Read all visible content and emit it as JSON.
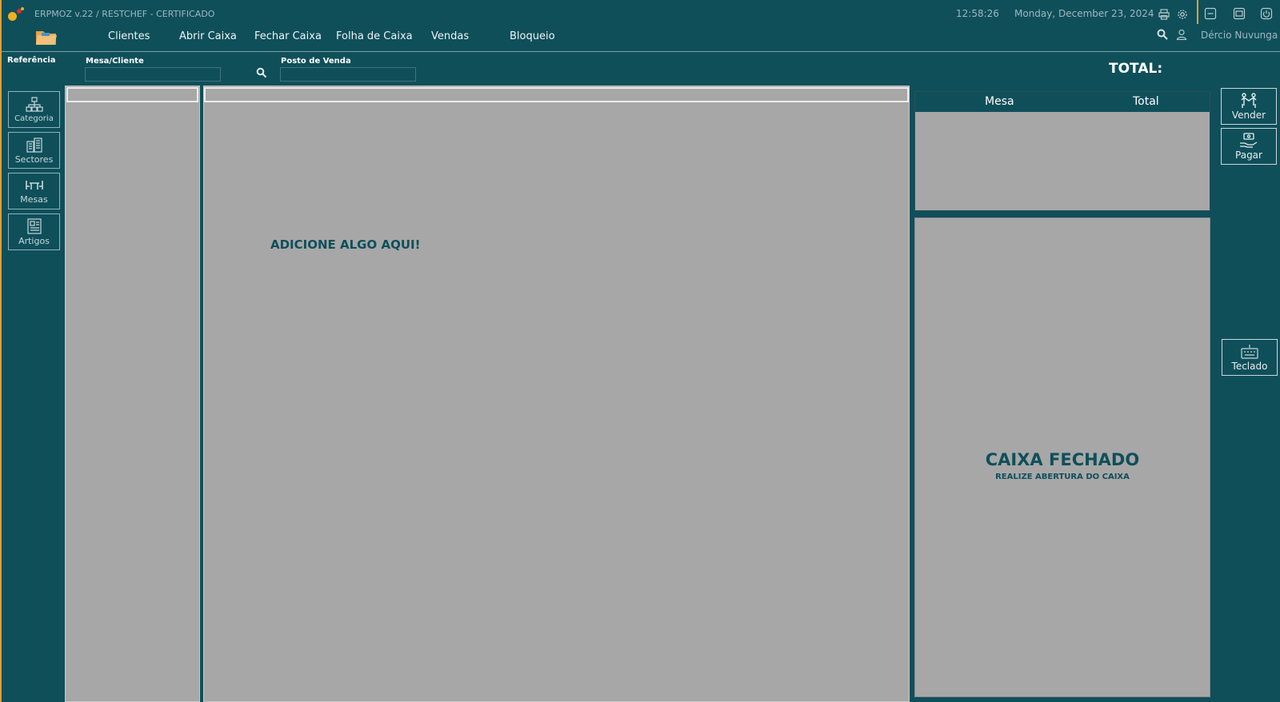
{
  "titlebar": {
    "app_title": "ERPMOZ v.22 / RESTCHEF - CERTIFICADO",
    "time": "12:58:26",
    "date": "Monday, December 23, 2024"
  },
  "menu": {
    "items": [
      "Clientes",
      "Abrir Caixa",
      "Fechar Caixa",
      "Folha de Caixa",
      "Vendas",
      "Bloqueio"
    ],
    "user": "Dércio Nuvunga"
  },
  "ref_row": {
    "referencia_label": "Referência",
    "mesa_cliente_label": "Mesa/Cliente",
    "mesa_cliente_value": "",
    "posto_label": "Posto de Venda",
    "posto_value": "",
    "total_label": "TOTAL:",
    "total_value": ""
  },
  "sidebar": {
    "items": [
      {
        "label": "Categoria",
        "icon": "sitemap-icon"
      },
      {
        "label": "Sectores",
        "icon": "building-icon"
      },
      {
        "label": "Mesas",
        "icon": "table-chairs-icon"
      },
      {
        "label": "Artigos",
        "icon": "list-icon"
      }
    ]
  },
  "main": {
    "empty_message": "ADICIONE ALGO AQUI!"
  },
  "mesa_table": {
    "columns": [
      "Mesa",
      "Total"
    ],
    "rows": []
  },
  "status": {
    "title": "CAIXA FECHADO",
    "subtitle": "REALIZE ABERTURA DO CAIXA"
  },
  "actions": {
    "vender": "Vender",
    "pagar": "Pagar",
    "teclado": "Teclado"
  },
  "colors": {
    "background": "#0f4f5a",
    "panel": "#a7a7a7",
    "accent": "#e0a030"
  }
}
